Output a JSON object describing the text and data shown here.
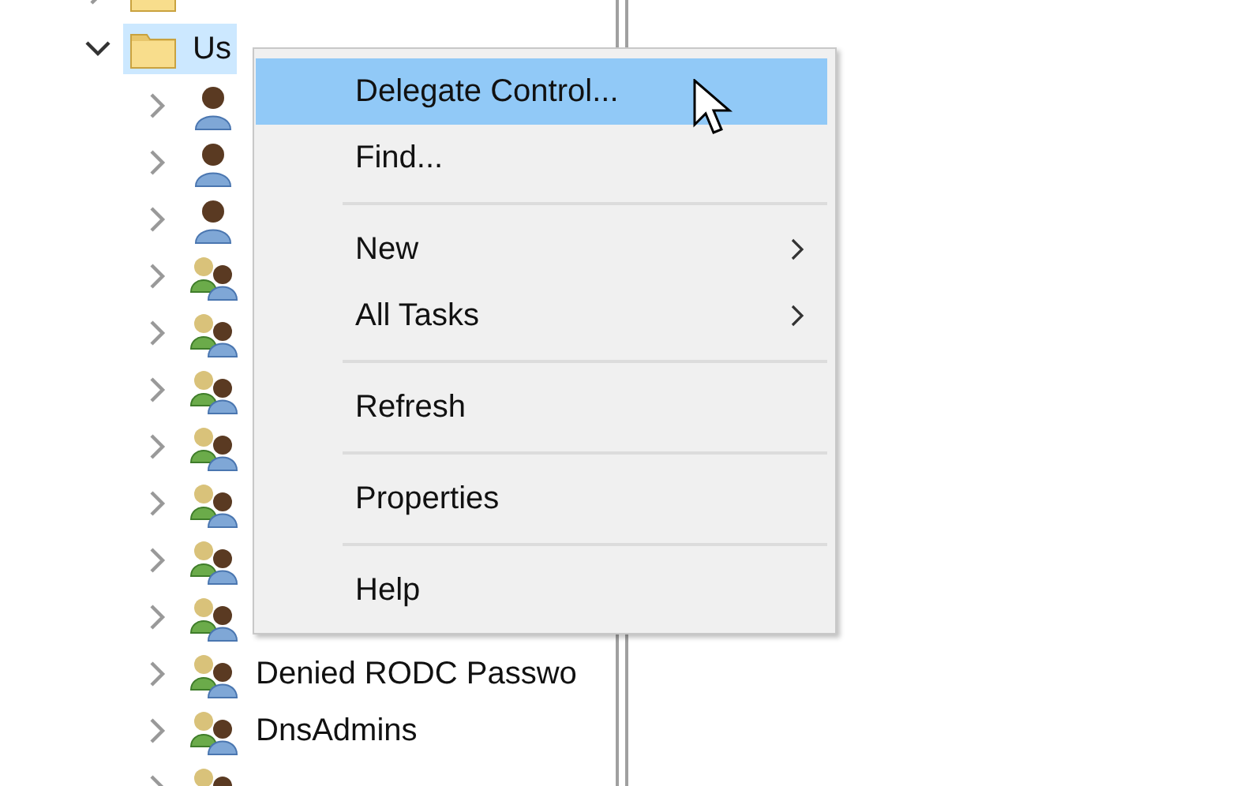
{
  "tree": {
    "items": [
      {
        "kind": "folder",
        "expanded": false,
        "selected": false
      },
      {
        "label": "Us",
        "kind": "folder",
        "expanded": true,
        "selected": true,
        "children": [
          {
            "kind": "user",
            "expanded": false
          },
          {
            "kind": "user",
            "expanded": false
          },
          {
            "kind": "user",
            "expanded": false
          },
          {
            "kind": "group",
            "expanded": false
          },
          {
            "kind": "group",
            "expanded": false
          },
          {
            "kind": "group",
            "expanded": false
          },
          {
            "kind": "group",
            "expanded": false
          },
          {
            "kind": "group",
            "expanded": false
          },
          {
            "kind": "group",
            "expanded": false
          },
          {
            "kind": "group",
            "expanded": false
          },
          {
            "label": "Denied RODC Passwo",
            "kind": "group",
            "expanded": false
          },
          {
            "label": "DnsAdmins",
            "kind": "group",
            "expanded": false
          },
          {
            "kind": "group",
            "expanded": false
          }
        ]
      }
    ]
  },
  "context_menu": {
    "items": [
      {
        "kind": "item",
        "label": "Delegate Control...",
        "selected": true
      },
      {
        "kind": "item",
        "label": "Find...",
        "selected": false
      },
      {
        "kind": "separator"
      },
      {
        "kind": "submenu",
        "label": "New",
        "selected": false
      },
      {
        "kind": "submenu",
        "label": "All Tasks",
        "selected": false
      },
      {
        "kind": "separator"
      },
      {
        "kind": "item",
        "label": "Refresh",
        "selected": false
      },
      {
        "kind": "separator"
      },
      {
        "kind": "item",
        "label": "Properties",
        "selected": false
      },
      {
        "kind": "separator"
      },
      {
        "kind": "item",
        "label": "Help",
        "selected": false
      }
    ]
  }
}
